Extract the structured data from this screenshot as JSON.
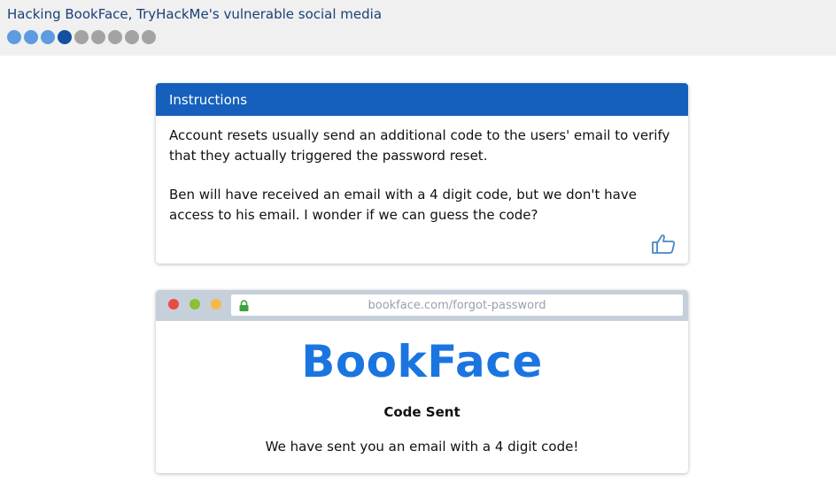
{
  "header": {
    "title": "Hacking BookFace, TryHackMe's vulnerable social media",
    "progress": {
      "total": 9,
      "completed": 3,
      "current": 4
    }
  },
  "instructions": {
    "heading": "Instructions",
    "paragraph1": "Account resets usually send an additional code to the users' email to verify that they actually triggered the password reset.",
    "paragraph2": "Ben will have received an email with a 4 digit code, but we don't have access to his email. I wonder if we can guess the code?",
    "next_icon": "thumbs-up-icon"
  },
  "browser": {
    "url": "bookface.com/forgot-password",
    "lock_icon": "lock-icon"
  },
  "site": {
    "brand": "BookFace",
    "heading": "Code Sent",
    "message": "We have sent you an email with a 4 digit code!"
  },
  "colors": {
    "accent": "#1560bd",
    "brand": "#1b75e0",
    "dot_done": "#5e9be0",
    "dot_current": "#144fa0",
    "dot_pending": "#a3a3a3",
    "lock": "#3aa33f"
  }
}
